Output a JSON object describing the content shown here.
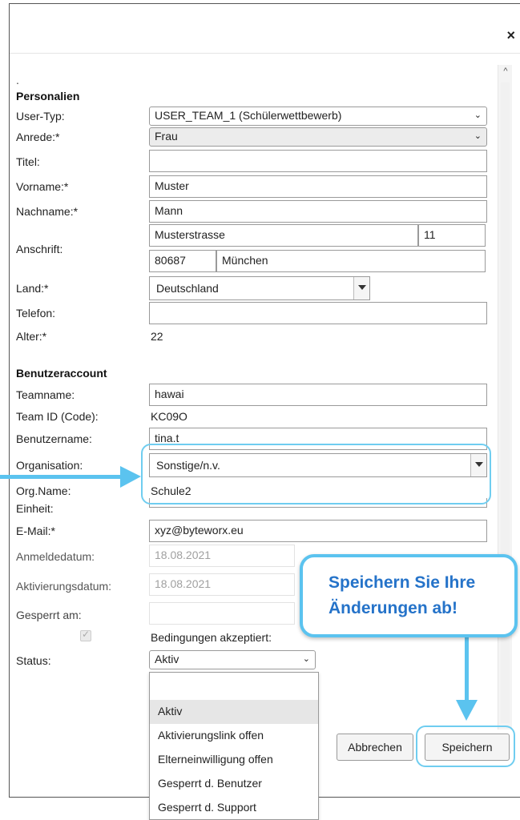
{
  "dialog": {
    "close_icon": "×",
    "dot": "."
  },
  "personalien": {
    "title": "Personalien",
    "user_typ": {
      "label": "User-Typ:",
      "value": "USER_TEAM_1 (Schülerwettbewerb)"
    },
    "anrede": {
      "label": "Anrede:*",
      "value": "Frau"
    },
    "titel": {
      "label": "Titel:",
      "value": ""
    },
    "vorname": {
      "label": "Vorname:*",
      "value": "Muster"
    },
    "nachname": {
      "label": "Nachname:*",
      "value": "Mann"
    },
    "anschrift": {
      "label": "Anschrift:",
      "strasse": "Musterstrasse",
      "hausnummer": "11",
      "plz": "80687",
      "ort": "München"
    },
    "land": {
      "label": "Land:*",
      "value": "Deutschland"
    },
    "telefon": {
      "label": "Telefon:",
      "value": ""
    },
    "alter": {
      "label": "Alter:*",
      "value": "22"
    }
  },
  "benutzeraccount": {
    "title": "Benutzeraccount",
    "teamname": {
      "label": "Teamname:",
      "value": "hawai"
    },
    "team_id": {
      "label": "Team ID (Code):",
      "value": "KC09O"
    },
    "benutzername": {
      "label": "Benutzername:",
      "value": "tina.t"
    },
    "organisation": {
      "label": "Organisation:",
      "value": "Sonstige/n.v."
    },
    "org_name": {
      "label": "Org.Name:",
      "value": "Schule2"
    },
    "einheit": {
      "label": "Einheit:",
      "value": ""
    },
    "email": {
      "label": "E-Mail:*",
      "value": "xyz@byteworx.eu"
    },
    "anmeldedatum": {
      "label": "Anmeldedatum:",
      "value": "18.08.2021"
    },
    "aktivierungsdatum": {
      "label": "Aktivierungsdatum:",
      "value": "18.08.2021"
    },
    "gesperrt_am": {
      "label": "Gesperrt am:",
      "value": ""
    },
    "bedingungen": {
      "label": "Bedingungen akzeptiert:",
      "checked": true
    },
    "status": {
      "label": "Status:",
      "value": "Aktiv"
    }
  },
  "status_dropdown": {
    "options": [
      "",
      "Aktiv",
      "Aktivierungslink offen",
      "Elterneinwilligung offen",
      "Gesperrt d. Benutzer",
      "Gesperrt d. Support"
    ],
    "highlighted": "Aktiv"
  },
  "buttons": {
    "abbrechen": "Abbrechen",
    "speichern": "Speichern"
  },
  "callout": {
    "line1": "Speichern Sie Ihre",
    "line2": "Änderungen ab!"
  },
  "colors": {
    "annotation": "#5bc3ef",
    "callout_text": "#2573c9"
  }
}
